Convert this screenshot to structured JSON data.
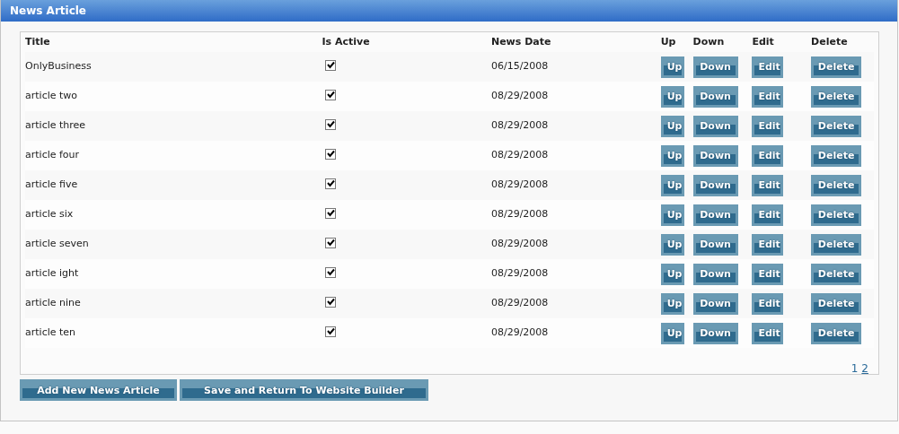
{
  "panel": {
    "title": "News Article"
  },
  "table": {
    "columns": [
      "Title",
      "Is Active",
      "News Date",
      "Up",
      "Down",
      "Edit",
      "Delete"
    ],
    "rows": [
      {
        "title": "OnlyBusiness",
        "active": true,
        "date": "06/15/2008",
        "up": "Up",
        "down": "Down",
        "edit": "Edit",
        "delete": "Delete"
      },
      {
        "title": "article two",
        "active": true,
        "date": "08/29/2008",
        "up": "Up",
        "down": "Down",
        "edit": "Edit",
        "delete": "Delete"
      },
      {
        "title": "article three",
        "active": true,
        "date": "08/29/2008",
        "up": "Up",
        "down": "Down",
        "edit": "Edit",
        "delete": "Delete"
      },
      {
        "title": "article four",
        "active": true,
        "date": "08/29/2008",
        "up": "Up",
        "down": "Down",
        "edit": "Edit",
        "delete": "Delete"
      },
      {
        "title": "article five",
        "active": true,
        "date": "08/29/2008",
        "up": "Up",
        "down": "Down",
        "edit": "Edit",
        "delete": "Delete"
      },
      {
        "title": "article six",
        "active": true,
        "date": "08/29/2008",
        "up": "Up",
        "down": "Down",
        "edit": "Edit",
        "delete": "Delete"
      },
      {
        "title": "article seven",
        "active": true,
        "date": "08/29/2008",
        "up": "Up",
        "down": "Down",
        "edit": "Edit",
        "delete": "Delete"
      },
      {
        "title": "article ight",
        "active": true,
        "date": "08/29/2008",
        "up": "Up",
        "down": "Down",
        "edit": "Edit",
        "delete": "Delete"
      },
      {
        "title": "article nine",
        "active": true,
        "date": "08/29/2008",
        "up": "Up",
        "down": "Down",
        "edit": "Edit",
        "delete": "Delete"
      },
      {
        "title": "article ten",
        "active": true,
        "date": "08/29/2008",
        "up": "Up",
        "down": "Down",
        "edit": "Edit",
        "delete": "Delete"
      }
    ]
  },
  "pages": [
    {
      "label": "1",
      "selected": true
    },
    {
      "label": "2",
      "selected": false
    }
  ],
  "buttons": [
    "Add New News Article",
    "Save and Return To Website Builder"
  ]
}
